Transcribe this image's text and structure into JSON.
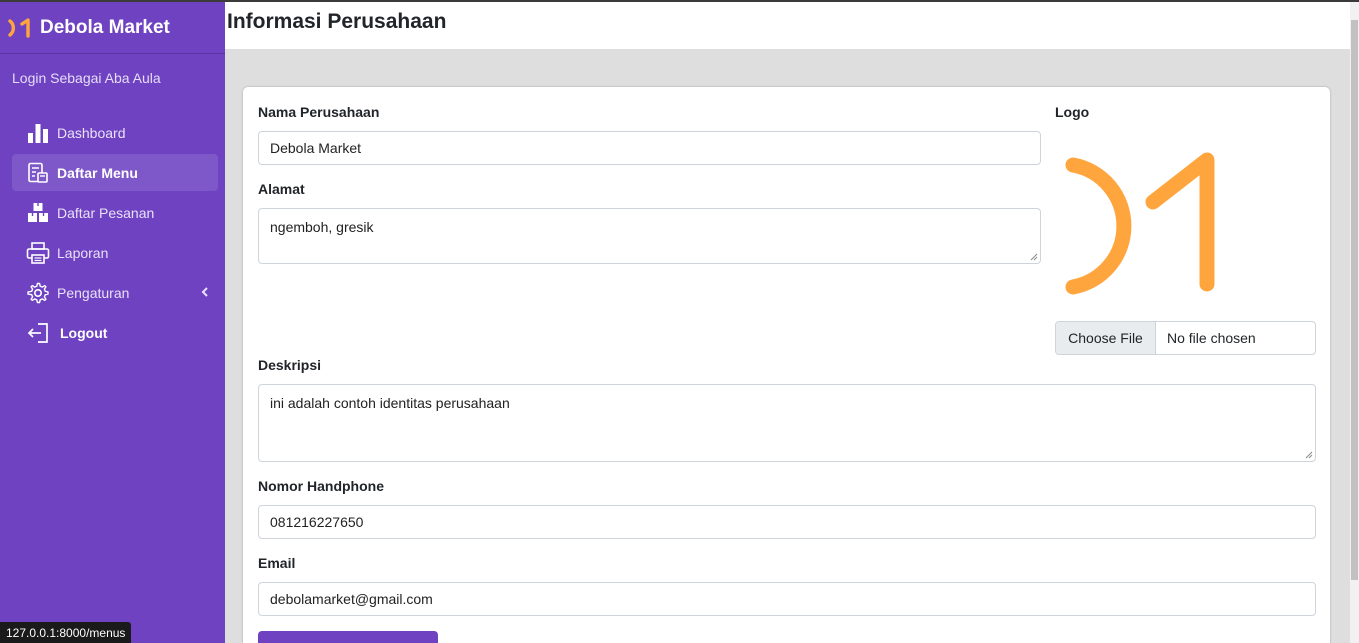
{
  "brand": {
    "name": "Debola Market"
  },
  "user_panel": {
    "text": "Login Sebagai Aba Aula"
  },
  "sidebar": {
    "items": [
      {
        "label": "Dashboard",
        "icon": "bar-chart-icon"
      },
      {
        "label": "Daftar Menu",
        "icon": "menu-list-icon",
        "active": true
      },
      {
        "label": "Daftar Pesanan",
        "icon": "boxes-icon"
      },
      {
        "label": "Laporan",
        "icon": "printer-icon"
      },
      {
        "label": "Pengaturan",
        "icon": "gear-icon"
      },
      {
        "label": "Logout",
        "icon": "logout-icon"
      }
    ]
  },
  "header": {
    "title": "Informasi Perusahaan"
  },
  "form": {
    "company_name_label": "Nama Perusahaan",
    "company_name_value": "Debola Market",
    "address_label": "Alamat",
    "address_value": "ngemboh, gresik",
    "logo_label": "Logo",
    "file_button": "Choose File",
    "file_status": "No file chosen",
    "description_label": "Deskripsi",
    "description_value": "ini adalah contoh identitas perusahaan",
    "phone_label": "Nomor Handphone",
    "phone_value": "081216227650",
    "email_label": "Email",
    "email_value": "debolamarket@gmail.com"
  },
  "status_bar": {
    "url": "127.0.0.1:8000/menus"
  },
  "colors": {
    "sidebar": "#6f42c1",
    "accent": "#ffa53e",
    "page_bg": "#dedede"
  }
}
